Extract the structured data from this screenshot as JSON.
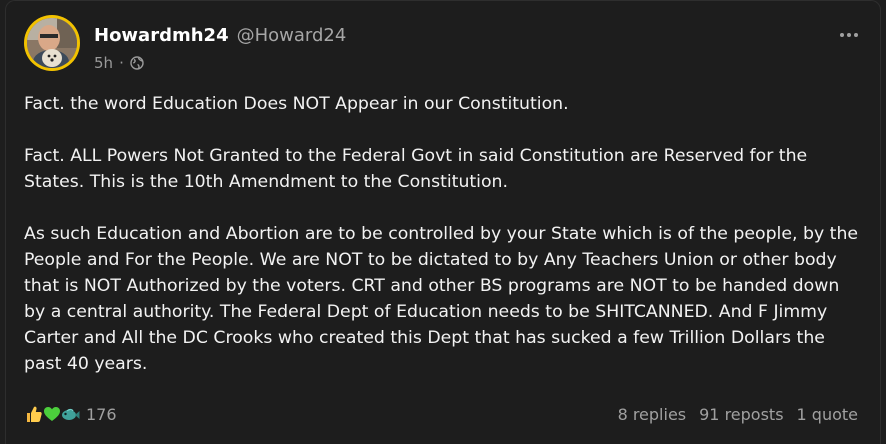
{
  "post": {
    "display_name": "Howardmh24",
    "handle": "@Howard24",
    "time_ago": "5h",
    "separator": "·",
    "visibility_icon": "globe-icon",
    "paragraphs": [
      "Fact. the word Education Does NOT Appear in our Constitution.",
      "Fact. ALL Powers Not Granted to the Federal Govt in said Constitution are Reserved for the States. This is the 10th Amendment to the Constitution.",
      "As such Education and Abortion are to be controlled by your State which is of the people, by the People and For the People. We are NOT to be dictated to by Any Teachers Union or other body that is NOT Authorized by the voters. CRT and other BS programs are NOT to be handed down by a central authority. The Federal Dept of Education needs to be SHITCANNED. And F Jimmy Carter and All the DC Crooks who created this Dept that has sucked a few Trillion Dollars the past 40 years."
    ],
    "reactions": {
      "icons": [
        "thumbs-up-icon",
        "green-heart-icon",
        "fish-icon"
      ],
      "count": "176"
    },
    "stats": {
      "replies": "8 replies",
      "reposts": "91 reposts",
      "quotes": "1 quote"
    }
  },
  "colors": {
    "background": "#1d1d1d",
    "avatar_ring": "#f2c200",
    "text": "#f2f2f2",
    "muted": "#a0a0a0"
  }
}
